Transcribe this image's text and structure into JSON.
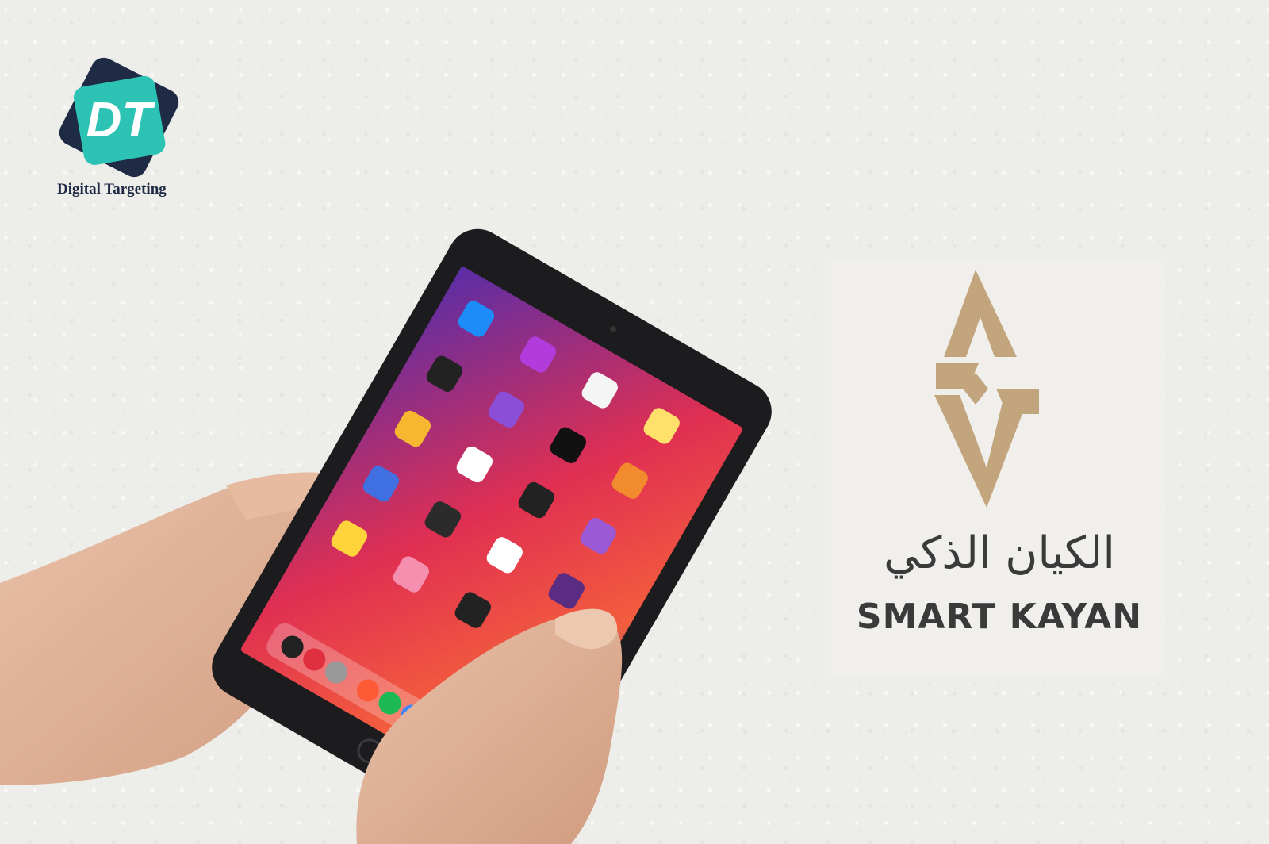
{
  "brand": {
    "dt_monogram": "DT",
    "dt_caption": "Digital Targeting"
  },
  "partner": {
    "arabic_name": "الكيان الذكي",
    "latin_name": "SMART KAYAN"
  },
  "colors": {
    "background": "#ededea",
    "dt_navy": "#1f2a44",
    "dt_teal": "#2cc3b5",
    "sk_gold": "#c2a57c",
    "sk_text": "#3a3a3a",
    "tablet_frame": "#1c1c1e"
  }
}
